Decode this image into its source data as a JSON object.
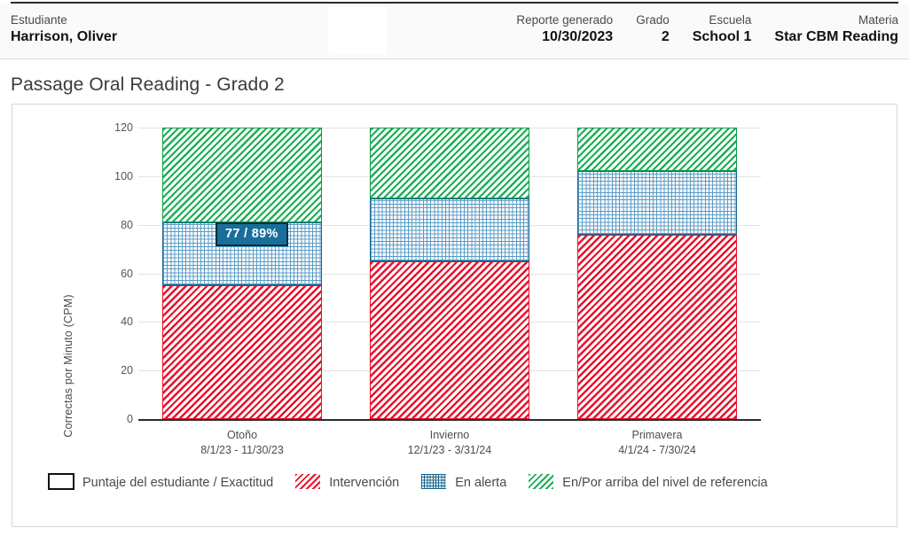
{
  "header": {
    "student_label": "Estudiante",
    "student_name": "Harrison, Oliver",
    "fields": [
      {
        "label": "Reporte generado",
        "value": "10/30/2023"
      },
      {
        "label": "Grado",
        "value": "2"
      },
      {
        "label": "Escuela",
        "value": "School 1"
      },
      {
        "label": "Materia",
        "value": "Star CBM Reading"
      }
    ]
  },
  "page_title": "Passage Oral Reading - Grado 2",
  "tooltip": {
    "text": "77 / 89%"
  },
  "legend": {
    "items": [
      {
        "swatch": "outline-box-swatch",
        "label": "Puntaje del estudiante / Exactitud"
      },
      {
        "swatch": "red-diagonal-hatch-swatch",
        "label": "Intervención"
      },
      {
        "swatch": "blue-crosshatch-swatch",
        "label": "En alerta"
      },
      {
        "swatch": "green-diagonal-hatch-swatch",
        "label": "En/Por arriba del nivel de referencia"
      }
    ]
  },
  "colors": {
    "intervention": "#e8112d",
    "on_watch": "#15658f",
    "at_above_benchmark": "#1aaf54",
    "tooltip_fill": "#1a6e9b",
    "tooltip_border": "#0c2c3d"
  },
  "chart_data": {
    "type": "bar",
    "stacked": true,
    "title": "Passage Oral Reading - Grado 2",
    "xlabel": "",
    "ylabel": "Correctas por Minuto (CPM)",
    "ylim": [
      0,
      120
    ],
    "yticks": [
      0,
      20,
      40,
      60,
      80,
      100,
      120
    ],
    "grid": true,
    "legend_position": "bottom",
    "categories": [
      "Otoño",
      "Invierno",
      "Primavera"
    ],
    "category_ranges": [
      "8/1/23 - 11/30/23",
      "12/1/23 - 3/31/24",
      "4/1/24 - 7/30/24"
    ],
    "series": [
      {
        "name": "Intervención",
        "color": "#e8112d",
        "values": [
          55,
          65,
          76
        ]
      },
      {
        "name": "En alerta",
        "color": "#15658f",
        "values": [
          26,
          26,
          26
        ]
      },
      {
        "name": "En/Por arriba del nivel de referencia",
        "color": "#1aaf54",
        "values": [
          39,
          29,
          18
        ]
      }
    ],
    "band_boundaries": [
      {
        "category": "Otoño",
        "intervention_top": 55,
        "on_watch_top": 81,
        "benchmark_top": 120
      },
      {
        "category": "Invierno",
        "intervention_top": 65,
        "on_watch_top": 91,
        "benchmark_top": 120
      },
      {
        "category": "Primavera",
        "intervention_top": 76,
        "on_watch_top": 102,
        "benchmark_top": 120
      }
    ],
    "annotations": [
      {
        "category": "Otoño",
        "text": "77 / 89%",
        "score": 77,
        "accuracy_pct": 89
      }
    ]
  }
}
